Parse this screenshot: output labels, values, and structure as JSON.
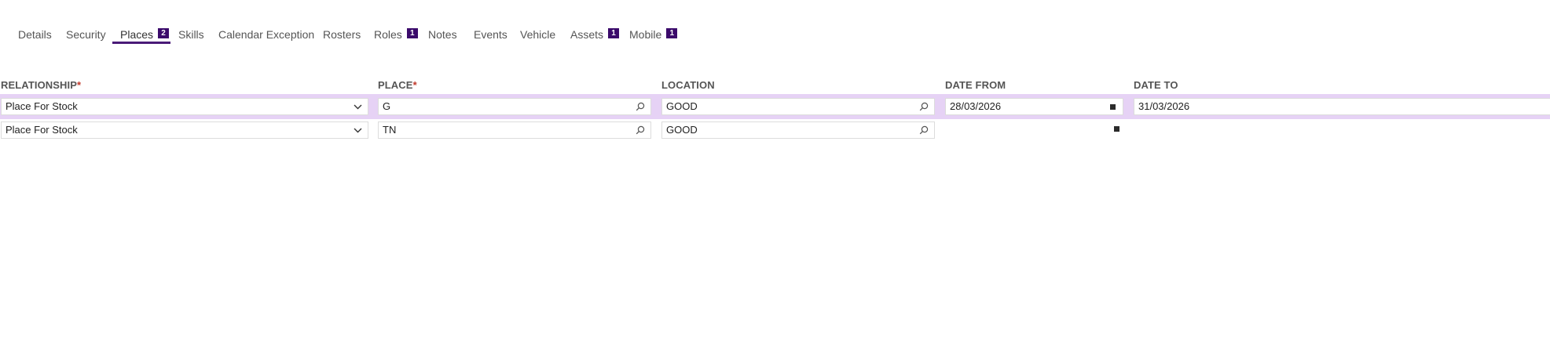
{
  "tabs": [
    {
      "label": "Details"
    },
    {
      "label": "Security"
    },
    {
      "label": "Places",
      "badge": "2",
      "active": true
    },
    {
      "label": "Skills"
    },
    {
      "label": "Calendar Exception"
    },
    {
      "label": "Rosters"
    },
    {
      "label": "Roles",
      "badge": "1"
    },
    {
      "label": "Notes"
    },
    {
      "label": "Events"
    },
    {
      "label": "Vehicle"
    },
    {
      "label": "Assets",
      "badge": "1"
    },
    {
      "label": "Mobile",
      "badge": "1"
    }
  ],
  "columns": {
    "relationship": {
      "label": "RELATIONSHIP",
      "required": "*"
    },
    "place": {
      "label": "PLACE",
      "required": "*"
    },
    "location": {
      "label": "LOCATION"
    },
    "date_from": {
      "label": "DATE FROM"
    },
    "date_to": {
      "label": "DATE TO"
    }
  },
  "rows": [
    {
      "relationship": "Place For Stock",
      "place": "G",
      "location": "GOOD",
      "date_from": "28/03/2026",
      "date_to": "31/03/2026"
    },
    {
      "relationship": "Place For Stock",
      "place": "TN",
      "location": "GOOD",
      "date_from": "",
      "date_to": ""
    }
  ],
  "icons": {
    "dropdown": "chevron-down-icon",
    "lookup": "search-icon",
    "calendar": "calendar-icon"
  },
  "colors": {
    "accent": "#4a1a78",
    "badge": "#3b0a6b",
    "row_highlight": "#e6d2f5",
    "required": "#c0392b"
  }
}
